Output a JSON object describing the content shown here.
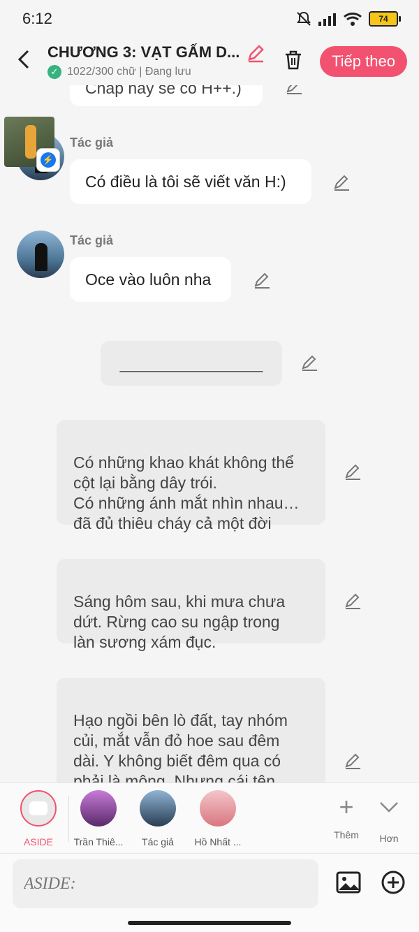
{
  "status": {
    "time": "6:12",
    "battery": "74"
  },
  "header": {
    "title": "CHƯƠNG 3: VẠT GẤM D...",
    "subtitle": "1022/300 chữ | Đang lưu",
    "next_label": "Tiếp theo"
  },
  "messages": {
    "partial": "Chấp nay sẽ có H++.)",
    "author1": "Tác giả",
    "msg1": "Có điều là tôi sẽ viết văn H:)",
    "author2": "Tác giả",
    "msg2": "Oce vào luôn nha",
    "divider": "________________",
    "narr1": "Có những khao khát không thể\ncột lại bằng dây trói.\nCó những ánh mắt nhìn nhau…\nđã đủ thiêu cháy cả một đời",
    "narr2": "Sáng hôm sau, khi mưa chưa\ndứt. Rừng cao su ngập trong\nlàn sương xám đục.",
    "narr3": "Hạo ngồi bên lò đất, tay nhóm\ncủi, mắt vẫn đỏ hoe sau đêm\ndài. Y không biết đêm qua có\nphải là mộng. Nhưng cái tên\n“Thiên Hạo” từ miệng công tử"
  },
  "characters": [
    {
      "label": "ASIDE"
    },
    {
      "label": "Trần Thiê..."
    },
    {
      "label": "Tác giả"
    },
    {
      "label": "Hồ Nhất ..."
    }
  ],
  "tools": {
    "more": "Thêm",
    "expand": "Hơn"
  },
  "input": {
    "placeholder": "ASIDE:"
  },
  "colors": {
    "accent": "#f2516f",
    "check": "#36b37e",
    "messenger": "#1877f2"
  }
}
